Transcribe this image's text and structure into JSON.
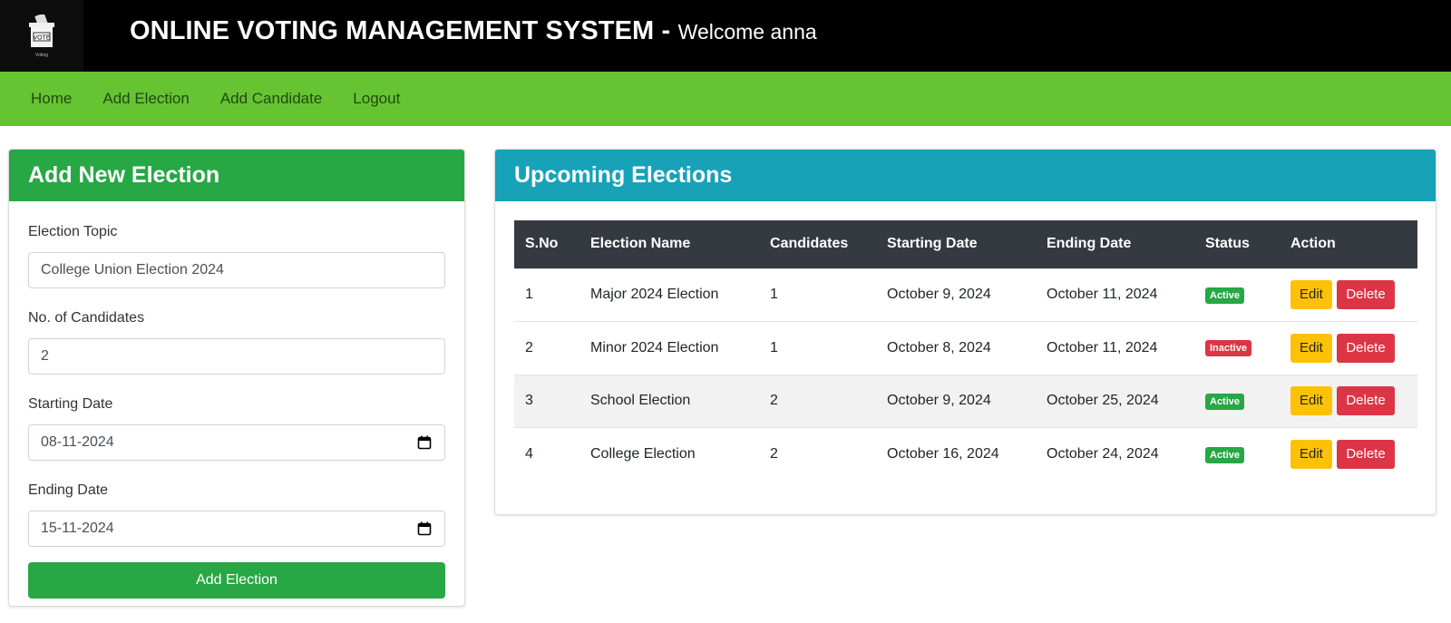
{
  "header": {
    "logo_text": "VOTE",
    "logo_sub": "Voting",
    "title": "ONLINE VOTING MANAGEMENT SYSTEM -",
    "welcome": "Welcome anna"
  },
  "nav": {
    "items": [
      "Home",
      "Add Election",
      "Add Candidate",
      "Logout"
    ]
  },
  "add_form": {
    "heading": "Add New Election",
    "topic_label": "Election Topic",
    "topic_value": "College Union Election 2024",
    "candidates_label": "No. of Candidates",
    "candidates_value": "2",
    "start_label": "Starting Date",
    "start_value": "08-11-2024",
    "end_label": "Ending Date",
    "end_value": "15-11-2024",
    "submit_label": "Add Election"
  },
  "upcoming": {
    "heading": "Upcoming Elections",
    "columns": [
      "S.No",
      "Election Name",
      "Candidates",
      "Starting Date",
      "Ending Date",
      "Status",
      "Action"
    ],
    "edit_label": "Edit",
    "delete_label": "Delete",
    "rows": [
      {
        "sno": "1",
        "name": "Major 2024 Election",
        "candidates": "1",
        "start": "October 9, 2024",
        "end": "October 11, 2024",
        "status": "Active"
      },
      {
        "sno": "2",
        "name": "Minor 2024 Election",
        "candidates": "1",
        "start": "October 8, 2024",
        "end": "October 11, 2024",
        "status": "Inactive"
      },
      {
        "sno": "3",
        "name": "School Election",
        "candidates": "2",
        "start": "October 9, 2024",
        "end": "October 25, 2024",
        "status": "Active"
      },
      {
        "sno": "4",
        "name": "College Election",
        "candidates": "2",
        "start": "October 16, 2024",
        "end": "October 24, 2024",
        "status": "Active"
      }
    ]
  },
  "colors": {
    "header_bg": "#000000",
    "nav_bg": "#66c332",
    "green": "#28a745",
    "teal": "#17a2b8",
    "dark": "#343a40",
    "warning": "#ffc107",
    "danger": "#dc3545"
  }
}
